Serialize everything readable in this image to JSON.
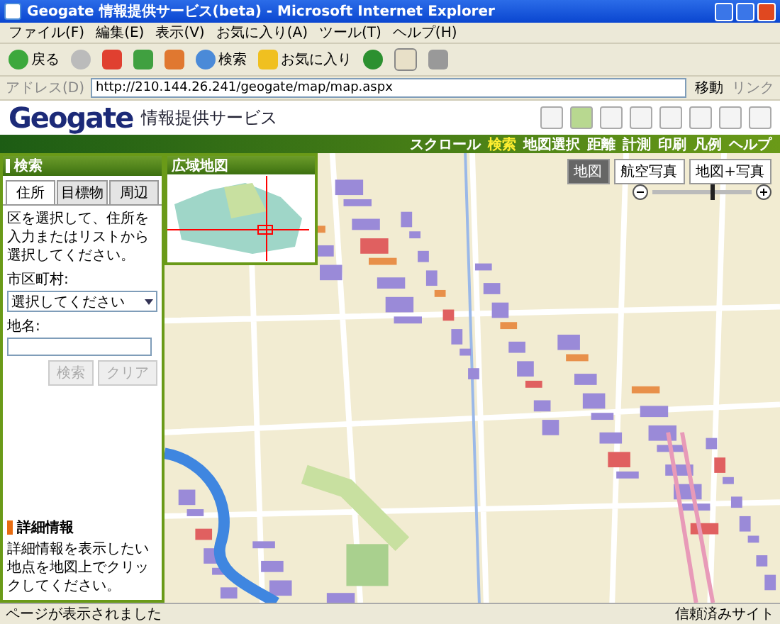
{
  "window": {
    "title": "Geogate 情報提供サービス(beta) - Microsoft Internet Explorer"
  },
  "menu": [
    "ファイル(F)",
    "編集(E)",
    "表示(V)",
    "お気に入り(A)",
    "ツール(T)",
    "ヘルプ(H)"
  ],
  "toolbar": [
    {
      "kind": "back",
      "label": "戻る"
    },
    {
      "kind": "forward"
    },
    {
      "kind": "stop"
    },
    {
      "kind": "refresh"
    },
    {
      "kind": "home"
    },
    {
      "kind": "search",
      "label": "検索"
    },
    {
      "kind": "favorites",
      "label": "お気に入り"
    },
    {
      "kind": "history"
    },
    {
      "kind": "mail"
    },
    {
      "kind": "print"
    }
  ],
  "address": {
    "label": "アドレス(D)",
    "value": "http://210.144.26.241/geogate/map/map.aspx",
    "go": "移動",
    "links": "リンク"
  },
  "header": {
    "logo": "Geogate",
    "subtitle": "情報提供サービス",
    "nav": [
      {
        "label": "スクロール",
        "selected": false
      },
      {
        "label": "検索",
        "selected": true
      },
      {
        "label": "地図選択",
        "selected": false
      },
      {
        "label": "距離",
        "selected": false
      },
      {
        "label": "計測",
        "selected": false
      },
      {
        "label": "印刷",
        "selected": false
      },
      {
        "label": "凡例",
        "selected": false
      },
      {
        "label": "ヘルプ",
        "selected": false
      }
    ]
  },
  "search": {
    "title": "検索",
    "tabs": [
      {
        "label": "住所",
        "selected": true
      },
      {
        "label": "目標物",
        "selected": false
      },
      {
        "label": "周辺",
        "selected": false
      }
    ],
    "instruction": "区を選択して、住所を入力またはリストから選択してください。",
    "city_label": "市区町村:",
    "city_value": "選択してください",
    "place_label": "地名:",
    "buttons": [
      {
        "label": "検索",
        "disabled": true
      },
      {
        "label": "クリア",
        "disabled": true
      }
    ]
  },
  "details": {
    "title": "詳細情報",
    "text": "詳細情報を表示したい地点を地図上でクリックしてください。"
  },
  "overview": {
    "title": "広域地図"
  },
  "map": {
    "views": [
      {
        "label": "地図",
        "selected": true
      },
      {
        "label": "航空写真",
        "selected": false
      },
      {
        "label": "地図+写真",
        "selected": false
      }
    ],
    "zoom": {
      "level": 0.6
    }
  },
  "status_bar": {
    "text": "ページが表示されました",
    "zone": "信頼済みサイト"
  }
}
